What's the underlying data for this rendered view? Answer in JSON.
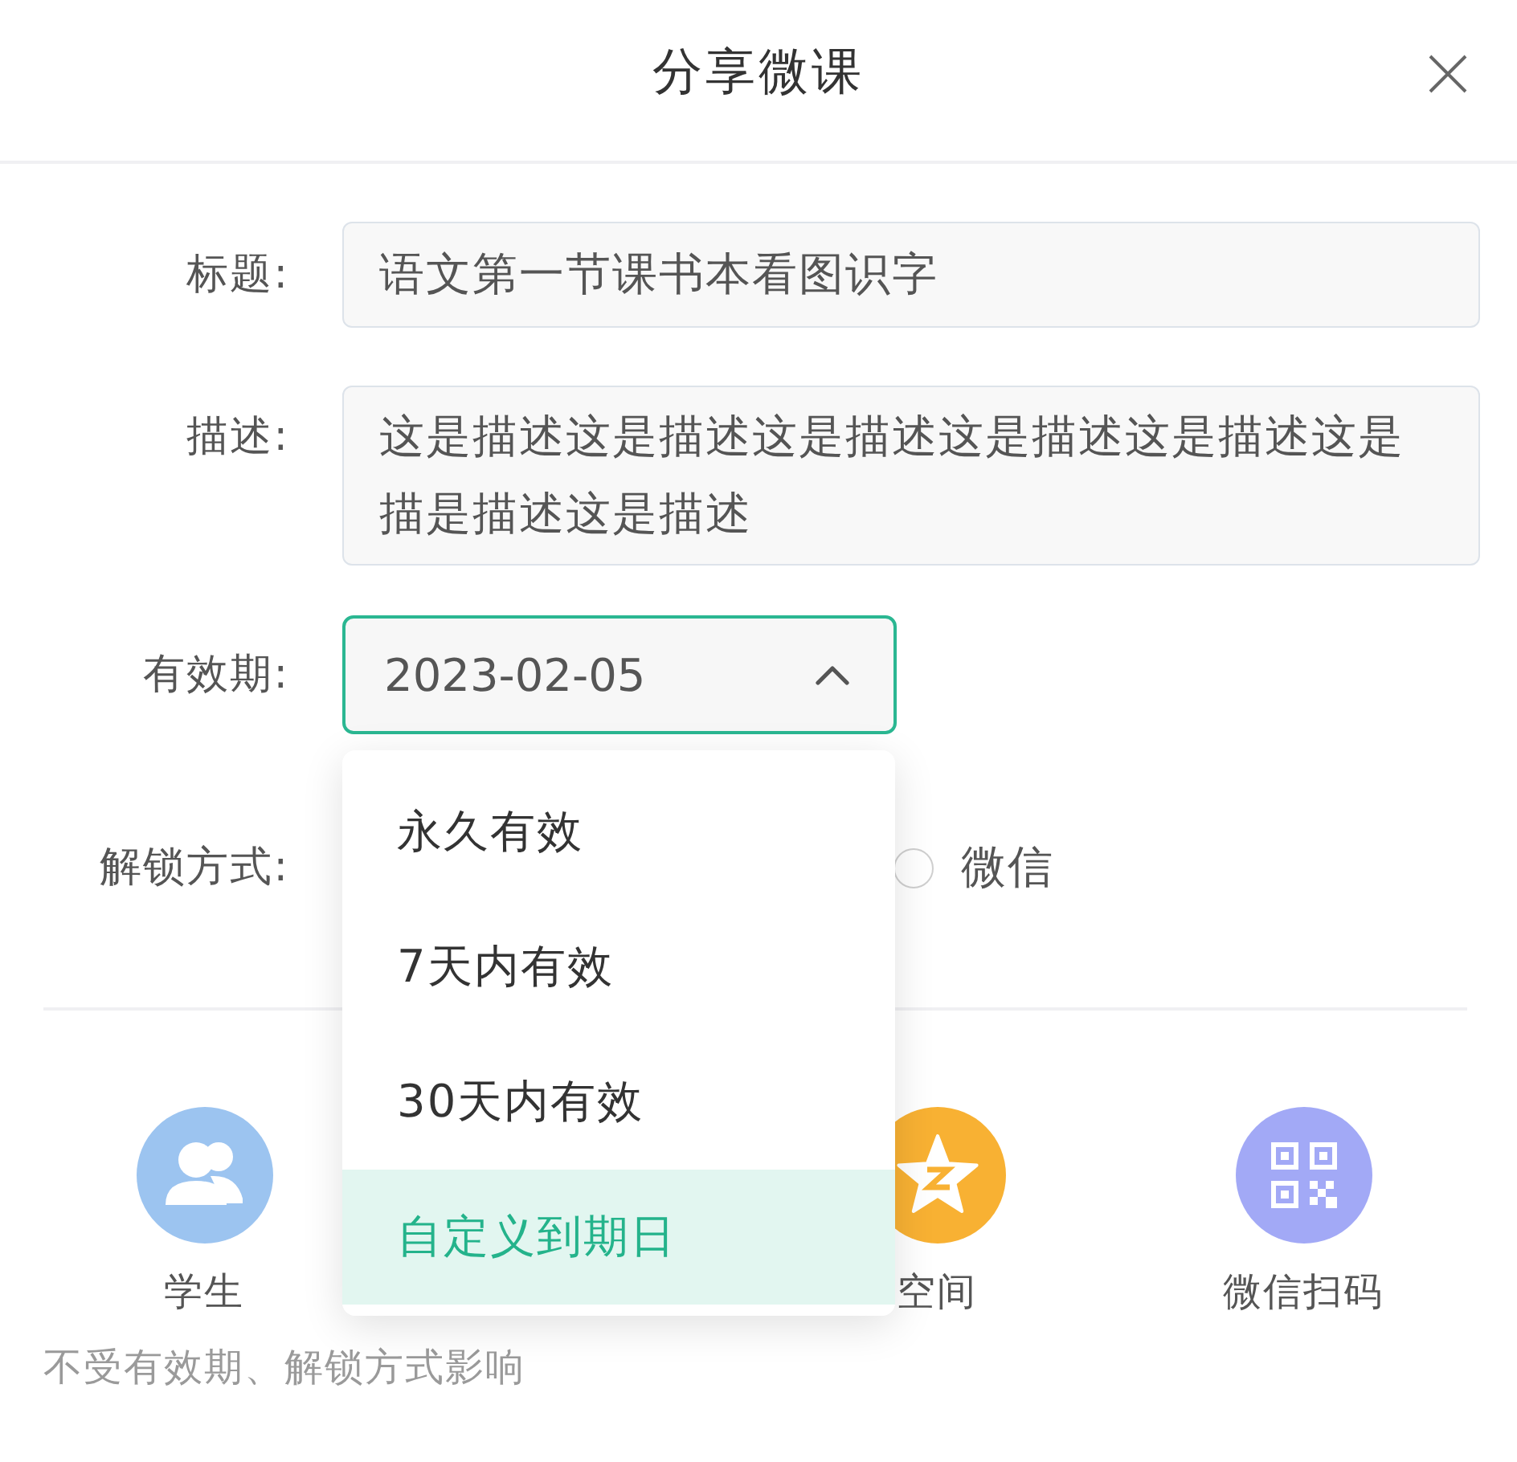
{
  "dialog": {
    "title": "分享微课"
  },
  "form": {
    "title_field": {
      "label": "标题:",
      "value": "语文第一节课书本看图识字"
    },
    "description_field": {
      "label": "描述:",
      "value": "这是描述这是描述这是描述这是描述这是描述这是描是描述这是描述"
    },
    "validity": {
      "label": "有效期:",
      "value": "2023-02-05",
      "expanded": true,
      "options": [
        {
          "label": "永久有效",
          "selected": false
        },
        {
          "label": "7天内有效",
          "selected": false
        },
        {
          "label": "30天内有效",
          "selected": false
        },
        {
          "label": "自定义到期日",
          "selected": true
        }
      ]
    },
    "unlock": {
      "label": "解锁方式:",
      "options": [
        {
          "label": "微信",
          "selected": false
        }
      ]
    }
  },
  "share": {
    "targets": [
      {
        "label": "学生",
        "kind": "group",
        "color": "#9cc4f0"
      },
      {
        "label": "空间",
        "kind": "star",
        "color": "#f8b133"
      },
      {
        "label": "微信扫码",
        "kind": "qr",
        "color": "#a2a9f6"
      }
    ],
    "note": "不受有效期、解锁方式影响"
  }
}
